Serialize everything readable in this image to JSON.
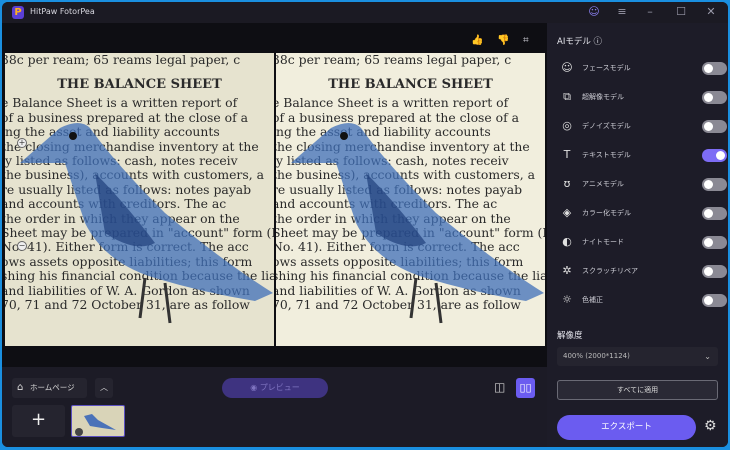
{
  "app": {
    "title": "HitPaw FotorPea",
    "logo_letter": "P"
  },
  "titlebar": {
    "icons": [
      "user-icon",
      "menu-icon",
      "minimize-icon",
      "maximize-icon",
      "close-icon"
    ]
  },
  "toolbar": {
    "icons": [
      "thumbs-up-icon",
      "thumbs-down-icon",
      "crop-icon"
    ]
  },
  "image_text": {
    "line1": "38c per ream; 65 reams legal paper, c",
    "heading": "THE BALANCE SHEET",
    "lines": [
      "e Balance Sheet is a written report of",
      "of a business prepared at the close of a",
      "ing the asset and liability accounts",
      "the closing merchandise inventory at the",
      "ly listed as follows: cash, notes receiv",
      "the business), accounts with customers, a",
      "re usually listed as follows: notes payab",
      "and accounts with creditors. The ac",
      "the order in which they appear on the",
      "Sheet may be prepared in \"account\" form (I",
      "No. 41). Either form is correct. The acc",
      "ows assets opposite liabilities; this form",
      "shing his financial condition because the liabili",
      "and liabilities of W. A. Gordon as shown",
      "70, 71 and 72 October 31, are as follow"
    ]
  },
  "bottom": {
    "home_label": "ホームページ",
    "preview_label": "プレビュー",
    "add_label": "+"
  },
  "sidebar": {
    "ai_title": "AIモデル",
    "models": [
      {
        "label": "フェースモデル",
        "icon": "face-icon",
        "on": false
      },
      {
        "label": "超解像モデル",
        "icon": "upscale-icon",
        "on": false
      },
      {
        "label": "デノイズモデル",
        "icon": "denoise-icon",
        "on": false
      },
      {
        "label": "テキストモデル",
        "icon": "text-icon",
        "on": true
      },
      {
        "label": "アニメモデル",
        "icon": "anime-icon",
        "on": false
      },
      {
        "label": "カラー化モデル",
        "icon": "colorize-icon",
        "on": false
      },
      {
        "label": "ナイトモード",
        "icon": "night-icon",
        "on": false
      },
      {
        "label": "スクラッチリペア",
        "icon": "scratch-icon",
        "on": false
      },
      {
        "label": "色補正",
        "icon": "color-correct-icon",
        "on": false
      }
    ],
    "resolution_title": "解像度",
    "resolution_value": "400% (2000*1124)",
    "apply_all_label": "すべてに適用",
    "export_label": "エクスポート"
  },
  "colors": {
    "accent": "#6b5cf0",
    "bg": "#1d1c28",
    "border": "#1a8fe0"
  }
}
